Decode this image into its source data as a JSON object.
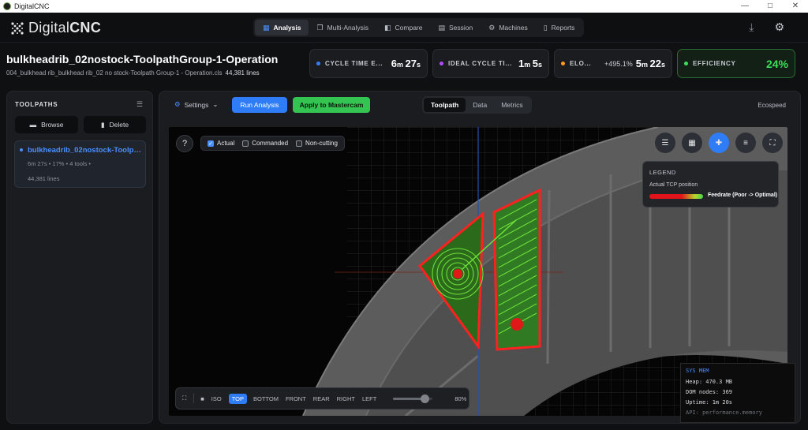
{
  "window": {
    "title": "DigitalCNC",
    "controls": [
      "—",
      "□",
      "✕"
    ]
  },
  "nav": {
    "brand_light": "Digital",
    "brand_bold": "CNC",
    "tabs": [
      {
        "label": "Analysis",
        "icon": "chart-icon",
        "active": true
      },
      {
        "label": "Multi-Analysis",
        "icon": "layers-icon",
        "active": false
      },
      {
        "label": "Compare",
        "icon": "compare-icon",
        "active": false
      },
      {
        "label": "Session",
        "icon": "session-icon",
        "active": false
      },
      {
        "label": "Machines",
        "icon": "machine-icon",
        "active": false
      },
      {
        "label": "Reports",
        "icon": "report-icon",
        "active": false
      }
    ]
  },
  "operation": {
    "title": "bulkheadrib_02nostock-ToolpathGroup-1-Operation",
    "file": "004_bulkhead rib_bulkhead rib_02 no stock-Toolpath Group-1 - Operation.cls",
    "lines": "44,381 lines"
  },
  "metrics": {
    "cycle": {
      "label": "CYCLE TIME E...",
      "m": "6",
      "s": "27",
      "color": "#3a7bff"
    },
    "ideal": {
      "label": "IDEAL CYCLE TI...",
      "m": "1",
      "s": "5",
      "color": "#b04cff"
    },
    "elo": {
      "label": "ELO...",
      "delta": "+495.1%",
      "m": "5",
      "s": "22",
      "color": "#ff9a1a"
    },
    "efficiency": {
      "label": "EFFICIENCY",
      "value": "24%",
      "color": "#3ddc5c"
    }
  },
  "sidebar": {
    "heading": "TOOLPATHS",
    "browse": "Browse",
    "delete": "Delete",
    "toolpath": {
      "name": "bulkheadrib_02nostock-Toolpath...",
      "time": "6m 27s",
      "pct": "17%",
      "tools": "4 tools",
      "lines": "44,381 lines"
    }
  },
  "toolbar": {
    "settings": "Settings",
    "run": "Run Analysis",
    "apply": "Apply to Mastercam",
    "tabs": [
      "Toolpath",
      "Data",
      "Metrics"
    ],
    "profile": "Ecospeed"
  },
  "viewport": {
    "help": "?",
    "checks": [
      {
        "label": "Actual",
        "checked": true
      },
      {
        "label": "Commanded",
        "checked": false
      },
      {
        "label": "Non-cutting",
        "checked": false
      }
    ],
    "legend": {
      "title": "LEGEND",
      "position": "Actual TCP position",
      "feed": "Feedrate (Poor -> Optimal)"
    },
    "views": [
      "ISO",
      "TOP",
      "BOTTOM",
      "FRONT",
      "REAR",
      "RIGHT",
      "LEFT"
    ],
    "active_view": "TOP",
    "zoom_label": "80%",
    "zoom_fraction": 0.8
  },
  "sysmem": {
    "title": "SYS MEM",
    "heap": "Heap: 470.3 MB",
    "nodes": "DOM nodes: 369",
    "uptime": "Uptime: 1m 20s",
    "api": "API: performance.memory"
  }
}
